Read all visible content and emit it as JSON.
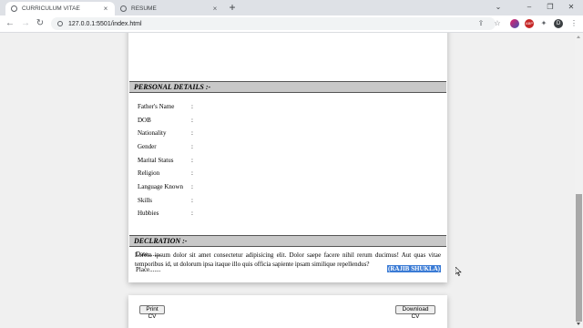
{
  "browser": {
    "tabs": [
      {
        "label": "CURRICULUM VITAE",
        "active": true
      },
      {
        "label": "RESUME",
        "active": false
      }
    ],
    "url": "127.0.0.1:5501/index.html",
    "extensions": [
      "share-icon",
      "star-icon",
      "color-extension",
      "abp-extension",
      "puzzle-icon",
      "profile-avatar",
      "menu-icon"
    ],
    "profile_initial": "D",
    "abp_label": "ABP"
  },
  "cv": {
    "personal_details": {
      "heading": "PERSONAL DETAILS :-",
      "rows": [
        {
          "label": "Father's Name",
          "colon": ":"
        },
        {
          "label": "DOB",
          "colon": ":"
        },
        {
          "label": "Nationality",
          "colon": ":"
        },
        {
          "label": "Gender",
          "colon": ":"
        },
        {
          "label": "Marital Status",
          "colon": ":"
        },
        {
          "label": "Religion",
          "colon": ":"
        },
        {
          "label": "Language Known",
          "colon": ":"
        },
        {
          "label": "Skills",
          "colon": ":"
        },
        {
          "label": "Hubbies",
          "colon": ":"
        }
      ]
    },
    "declaration": {
      "heading": "DECLRATION :-",
      "text": "Lorem ipsum dolor sit amet consectetur adipisicing elit. Dolor saepe facere nihil rerum ducimus! Aut quas vitae temporibus id, ut dolorum ipsa itaque illo quis officia sapiente ipsam similique repellendus?",
      "date_label": "Date........",
      "place_label": "Place.......",
      "signature": "(RAJIB SHUKLA)"
    }
  },
  "actions": {
    "print_label": "Print CV",
    "download_label": "Download CV"
  }
}
